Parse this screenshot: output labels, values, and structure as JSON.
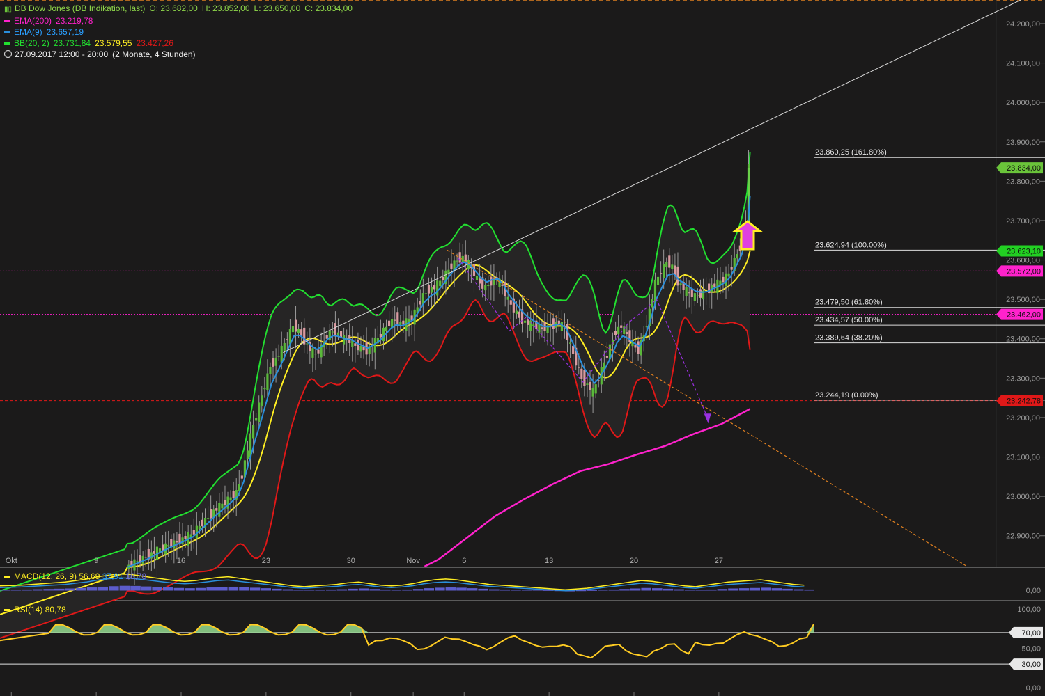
{
  "instrument": {
    "name": "DB Dow Jones (DB Indikation, last)",
    "open": "O: 23.682,00",
    "high": "H: 23.852,00",
    "low": "L: 23.650,00",
    "close": "C: 23.834,00"
  },
  "indicators": {
    "ema200": {
      "label": "EMA(200)",
      "value": "23.219,78",
      "color": "#ff22cc"
    },
    "ema9": {
      "label": "EMA(9)",
      "value": "23.657,19",
      "color": "#2a8fdc"
    },
    "bb": {
      "label": "BB(20, 2)",
      "upper": "23.731,84",
      "middle": "23.579,55",
      "lower": "23.427,26",
      "colors": {
        "upper": "#22e030",
        "middle": "#ffee22",
        "lower": "#e01818"
      }
    },
    "period": "27.09.2017 12:00 - 20:00",
    "period_note": "(2 Monate, 4 Stunden)"
  },
  "macd": {
    "label": "MACD(12, 26, 9)",
    "v1": "56,69",
    "v2": "37,91",
    "v3": "18,78",
    "zero_label": "0,00"
  },
  "rsi": {
    "label": "RSI(14)",
    "value": "80,78",
    "ticks": [
      "100,00",
      "70,00",
      "50,00",
      "30,00",
      "0,00"
    ]
  },
  "chart_data": {
    "type": "line",
    "y_axis": {
      "ylim": [
        22820,
        24260
      ],
      "ticks": [
        24200,
        24100,
        24000,
        23900,
        23800,
        23700,
        23600,
        23500,
        23400,
        23300,
        23200,
        23100,
        23000,
        22900
      ],
      "tick_labels": [
        "24.200,00",
        "24.100,00",
        "24.000,00",
        "23.900,00",
        "23.800,00",
        "23.700,00",
        "23.600,00",
        "23.500,00",
        "23.400,00",
        "23.300,00",
        "23.200,00",
        "23.100,00",
        "23.000,00",
        "22.900,00"
      ]
    },
    "x_labels": [
      {
        "label": "Okt",
        "xi": 4
      },
      {
        "label": "9",
        "xi": 34
      },
      {
        "label": "16",
        "xi": 64
      },
      {
        "label": "23",
        "xi": 94
      },
      {
        "label": "30",
        "xi": 124
      },
      {
        "label": "Nov",
        "xi": 146
      },
      {
        "label": "6",
        "xi": 164
      },
      {
        "label": "13",
        "xi": 194
      },
      {
        "label": "20",
        "xi": 224
      },
      {
        "label": "27",
        "xi": 254
      }
    ],
    "price_badges": [
      {
        "label": "23.834,00",
        "value": 23834,
        "color": "#6ac43a"
      },
      {
        "label": "23.623,10",
        "value": 23623,
        "color": "#22d022"
      },
      {
        "label": "23.572,00",
        "value": 23572,
        "color": "#ff22cc"
      },
      {
        "label": "23.462,00",
        "value": 23462,
        "color": "#ff22cc"
      },
      {
        "label": "23.242,78",
        "value": 23243,
        "color": "#e01818"
      }
    ],
    "fibonacci": [
      {
        "label": "23.860,25 (161.80%)",
        "value": 23860.25
      },
      {
        "label": "23.624,94 (100.00%)",
        "value": 23624.94
      },
      {
        "label": "23.479,50 (61.80%)",
        "value": 23479.5
      },
      {
        "label": "23.434,57 (50.00%)",
        "value": 23434.57
      },
      {
        "label": "23.389,64 (38.20%)",
        "value": 23389.64
      },
      {
        "label": "23.244,19 (0.00%)",
        "value": 23244.19
      }
    ],
    "close_series": [
      [
        45,
        22820
      ],
      [
        48,
        22832
      ],
      [
        52,
        22846
      ],
      [
        56,
        22862
      ],
      [
        60,
        22876
      ],
      [
        64,
        22888
      ],
      [
        68,
        22902
      ],
      [
        72,
        22932
      ],
      [
        76,
        22962
      ],
      [
        80,
        22985
      ],
      [
        84,
        23010
      ],
      [
        86,
        23055
      ],
      [
        88,
        23120
      ],
      [
        90,
        23180
      ],
      [
        92,
        23230
      ],
      [
        94,
        23282
      ],
      [
        96,
        23330
      ],
      [
        98,
        23348
      ],
      [
        100,
        23372
      ],
      [
        102,
        23402
      ],
      [
        104,
        23432
      ],
      [
        106,
        23420
      ],
      [
        108,
        23396
      ],
      [
        110,
        23372
      ],
      [
        112,
        23360
      ],
      [
        114,
        23378
      ],
      [
        116,
        23408
      ],
      [
        118,
        23420
      ],
      [
        120,
        23412
      ],
      [
        122,
        23400
      ],
      [
        124,
        23395
      ],
      [
        126,
        23382
      ],
      [
        128,
        23376
      ],
      [
        130,
        23370
      ],
      [
        132,
        23385
      ],
      [
        134,
        23400
      ],
      [
        136,
        23420
      ],
      [
        138,
        23440
      ],
      [
        140,
        23448
      ],
      [
        142,
        23438
      ],
      [
        144,
        23442
      ],
      [
        146,
        23452
      ],
      [
        148,
        23480
      ],
      [
        150,
        23510
      ],
      [
        152,
        23525
      ],
      [
        154,
        23530
      ],
      [
        156,
        23545
      ],
      [
        158,
        23565
      ],
      [
        160,
        23585
      ],
      [
        162,
        23600
      ],
      [
        164,
        23606
      ],
      [
        166,
        23590
      ],
      [
        168,
        23565
      ],
      [
        170,
        23540
      ],
      [
        172,
        23530
      ],
      [
        174,
        23545
      ],
      [
        176,
        23552
      ],
      [
        178,
        23532
      ],
      [
        180,
        23498
      ],
      [
        182,
        23475
      ],
      [
        184,
        23455
      ],
      [
        186,
        23442
      ],
      [
        188,
        23436
      ],
      [
        190,
        23432
      ],
      [
        192,
        23426
      ],
      [
        194,
        23428
      ],
      [
        196,
        23436
      ],
      [
        198,
        23440
      ],
      [
        200,
        23425
      ],
      [
        202,
        23382
      ],
      [
        204,
        23340
      ],
      [
        206,
        23300
      ],
      [
        208,
        23282
      ],
      [
        210,
        23265
      ],
      [
        212,
        23300
      ],
      [
        214,
        23340
      ],
      [
        216,
        23380
      ],
      [
        218,
        23420
      ],
      [
        220,
        23432
      ],
      [
        222,
        23410
      ],
      [
        224,
        23385
      ],
      [
        226,
        23370
      ],
      [
        228,
        23410
      ],
      [
        230,
        23472
      ],
      [
        232,
        23540
      ],
      [
        234,
        23570
      ],
      [
        236,
        23595
      ],
      [
        238,
        23582
      ],
      [
        240,
        23545
      ],
      [
        242,
        23528
      ],
      [
        244,
        23515
      ],
      [
        246,
        23508
      ],
      [
        248,
        23512
      ],
      [
        250,
        23520
      ],
      [
        252,
        23532
      ],
      [
        254,
        23540
      ],
      [
        256,
        23550
      ],
      [
        258,
        23566
      ],
      [
        260,
        23600
      ],
      [
        262,
        23634
      ],
      [
        264,
        23700
      ],
      [
        265,
        23834
      ]
    ],
    "ema200_series": [
      [
        150,
        22822
      ],
      [
        155,
        22840
      ],
      [
        165,
        22895
      ],
      [
        175,
        22950
      ],
      [
        185,
        22992
      ],
      [
        195,
        23030
      ],
      [
        205,
        23064
      ],
      [
        215,
        23082
      ],
      [
        225,
        23106
      ],
      [
        235,
        23128
      ],
      [
        245,
        23158
      ],
      [
        255,
        23184
      ],
      [
        265,
        23222
      ]
    ],
    "macd_values": [
      4,
      5,
      6,
      8,
      10,
      12,
      14,
      18,
      22,
      28,
      32,
      35,
      34,
      30,
      26,
      22,
      18,
      16,
      18,
      22,
      26,
      28,
      24,
      20,
      16,
      12,
      8,
      4,
      2,
      4,
      6,
      8,
      12,
      14,
      10,
      6,
      4,
      6,
      10,
      16,
      20,
      22,
      20,
      16,
      12,
      8,
      6,
      4,
      2,
      0,
      -2,
      -4,
      -6,
      -4,
      -2,
      2,
      6,
      10,
      14,
      18,
      16,
      12,
      8,
      4,
      2,
      6,
      10,
      14,
      16,
      18,
      20,
      16,
      12,
      8,
      6
    ]
  }
}
